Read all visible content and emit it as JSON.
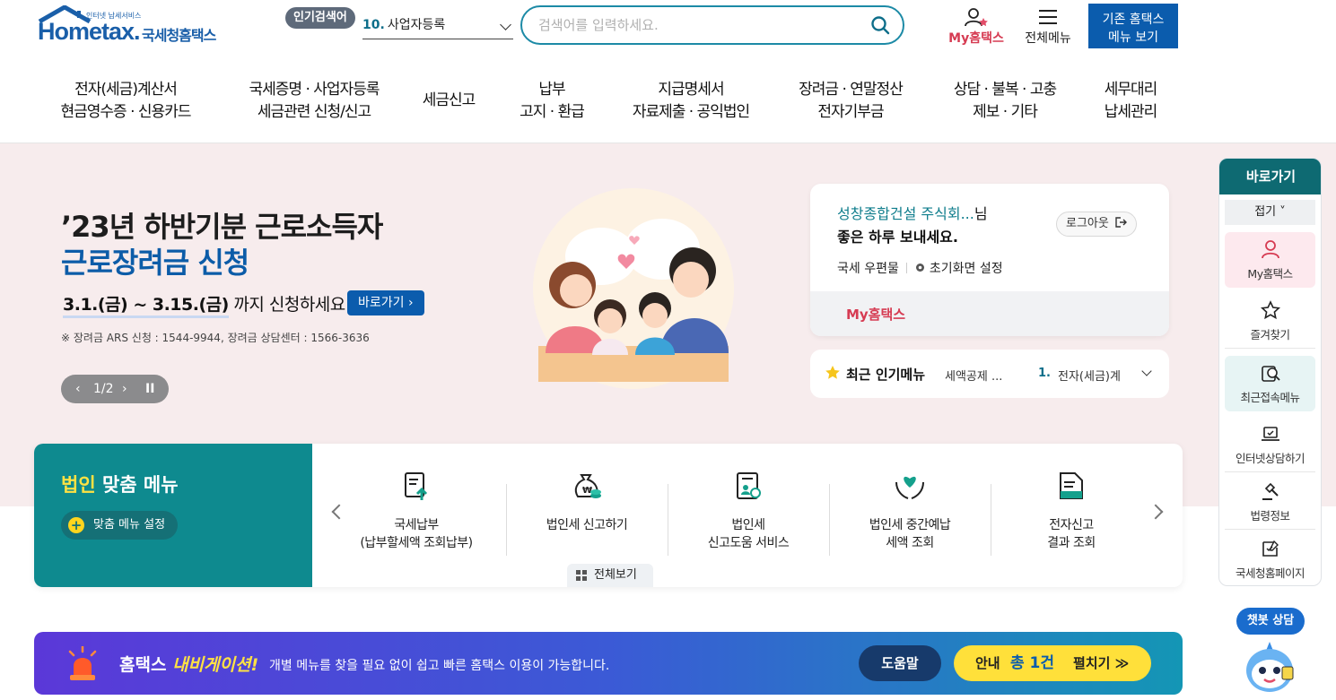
{
  "header": {
    "logo_small": "인터넷 납세서비스",
    "logo_text": "Hometax.",
    "logo_sub": "국세청홈택스",
    "popular_badge": "인기검색어",
    "popular_num": "10.",
    "popular_term": "사업자등록",
    "search_placeholder": "검색어를 입력하세요.",
    "my_hometax": "My홈택스",
    "all_menu": "전체메뉴",
    "old_menu_line1": "기존 홈택스",
    "old_menu_line2": "메뉴 보기"
  },
  "gnb": [
    {
      "l1": "전자(세금)계산서",
      "l2": "현금영수증 · 신용카드"
    },
    {
      "l1": "국세증명 · 사업자등록",
      "l2": "세금관련 신청/신고"
    },
    {
      "l1": "세금신고",
      "l2": ""
    },
    {
      "l1": "납부",
      "l2": "고지 · 환급"
    },
    {
      "l1": "지급명세서",
      "l2": "자료제출 · 공익법인"
    },
    {
      "l1": "장려금 · 연말정산",
      "l2": "전자기부금"
    },
    {
      "l1": "상담 · 불복 · 고충",
      "l2": "제보 · 기타"
    },
    {
      "l1": "세무대리",
      "l2": "납세관리"
    }
  ],
  "hero": {
    "title1": "’23년 하반기분 근로소득자",
    "title2": "근로장려금 신청",
    "period_dates": "3.1.(금) ~ 3.15.(금)",
    "period_suffix": " 까지 신청하세요!",
    "goto_label": "바로가기",
    "note": "※ 장려금 ARS 신청 : 1544-9944, 장려금 상담센터 : 1566-3636",
    "slide_prev": "‹",
    "slide_count": "1/2",
    "slide_next": "›",
    "slide_pause": "II"
  },
  "login": {
    "company": "성창종합건설 주식회...",
    "nim": "님",
    "greeting": "좋은 하루 보내세요.",
    "logout": "로그아웃",
    "mailbox": "국세 우편물",
    "home_setting": "초기화면 설정",
    "my_hometax": "My홈택스"
  },
  "recent": {
    "title": "최근 인기메뉴",
    "value": "세액공제 ...",
    "rank": "1.",
    "popular": "전자(세금)계"
  },
  "corp": {
    "title_hl": "법인",
    "title_rest": " 맞춤 메뉴",
    "setting": "맞춤 메뉴 설정",
    "items": [
      {
        "label": "국세납부\n(납부할세액 조회납부)",
        "icon": "tax-payment-icon"
      },
      {
        "label": "법인세 신고하기",
        "icon": "money-bag-icon"
      },
      {
        "label": "법인세\n신고도움 서비스",
        "icon": "tax-help-document-icon"
      },
      {
        "label": "법인세 중간예납\n세액 조회",
        "icon": "heart-hands-icon"
      },
      {
        "label": "전자신고\n결과 조회",
        "icon": "document-result-icon"
      }
    ],
    "view_all": "전체보기"
  },
  "nav_banner": {
    "title_a": "홈택스 ",
    "title_b": "내비게이션!",
    "desc": "개별 메뉴를 찾을 필요 없이 쉽고 빠른 홈택스 이용이 가능합니다.",
    "help": "도움말",
    "notice_a": "안내",
    "notice_b": "총 1건",
    "notice_c": "펼치기 ≫"
  },
  "quick": {
    "head": "바로가기",
    "fold": "접기 ˅",
    "items": [
      {
        "label": "My홈택스",
        "icon": "user-icon"
      },
      {
        "label": "즐겨찾기",
        "icon": "star-icon"
      },
      {
        "label": "최근접속메뉴",
        "icon": "recent-search-icon"
      },
      {
        "label": "인터넷상담하기",
        "icon": "laptop-icon"
      },
      {
        "label": "법령정보",
        "icon": "gavel-icon"
      },
      {
        "label": "국세청홈페이지",
        "icon": "edit-board-icon"
      }
    ]
  },
  "chatbot": {
    "label": "챗봇 상담"
  },
  "colors": {
    "brand_blue": "#0b5cad",
    "teal": "#0e8a8f",
    "accent_red": "#d63b52",
    "hero_bg": "#f7eced",
    "highlight_yellow": "#ffe243"
  }
}
